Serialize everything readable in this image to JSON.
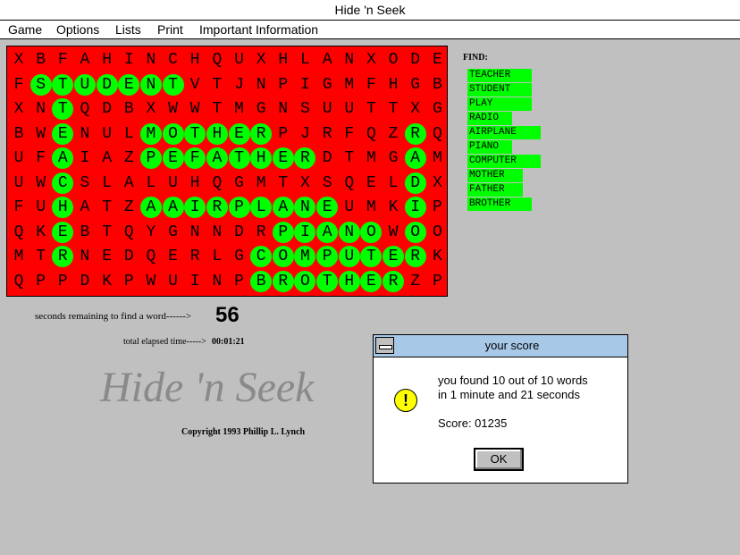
{
  "window": {
    "title": "Hide 'n Seek"
  },
  "menu": [
    "Game",
    "Options",
    "Lists",
    "Print",
    "Important Information"
  ],
  "grid": {
    "rows": [
      "XBFAHINCHQUXHLANXODE",
      "FSTUDENTVTJNPIGMFHGB",
      "XNTQDBXWWTMGNSUUTTXG",
      "BWENULMOTHERPJRFQZRQ",
      "UFAIAZPEFATHERDTMGAM",
      "UWCSLALUHQGMTXSQELDX",
      "FUHATZAAIRPLANEUMKIP",
      "QKEBTQYGNNDRPIANOWOO",
      "MTRNEDQERLGCOMPUTERK",
      "QPPDKPWUINPBROTHERZP"
    ],
    "found_words_cells": [
      [
        1,
        1
      ],
      [
        1,
        2
      ],
      [
        1,
        3
      ],
      [
        1,
        4
      ],
      [
        1,
        5
      ],
      [
        1,
        6
      ],
      [
        1,
        7
      ],
      [
        2,
        2
      ],
      [
        3,
        2
      ],
      [
        4,
        2
      ],
      [
        5,
        2
      ],
      [
        6,
        2
      ],
      [
        7,
        2
      ],
      [
        8,
        2
      ],
      [
        3,
        6
      ],
      [
        3,
        7
      ],
      [
        3,
        8
      ],
      [
        3,
        9
      ],
      [
        3,
        10
      ],
      [
        3,
        11
      ],
      [
        4,
        6
      ],
      [
        4,
        7
      ],
      [
        4,
        8
      ],
      [
        4,
        9
      ],
      [
        4,
        10
      ],
      [
        4,
        11
      ],
      [
        4,
        12
      ],
      [
        4,
        13
      ],
      [
        3,
        18
      ],
      [
        4,
        18
      ],
      [
        5,
        18
      ],
      [
        6,
        18
      ],
      [
        7,
        18
      ],
      [
        6,
        6
      ],
      [
        6,
        7
      ],
      [
        6,
        8
      ],
      [
        6,
        9
      ],
      [
        6,
        10
      ],
      [
        6,
        11
      ],
      [
        6,
        12
      ],
      [
        6,
        13
      ],
      [
        6,
        14
      ],
      [
        7,
        12
      ],
      [
        7,
        13
      ],
      [
        7,
        14
      ],
      [
        7,
        15
      ],
      [
        7,
        16
      ],
      [
        8,
        11
      ],
      [
        8,
        12
      ],
      [
        8,
        13
      ],
      [
        8,
        14
      ],
      [
        8,
        15
      ],
      [
        8,
        16
      ],
      [
        8,
        17
      ],
      [
        8,
        18
      ],
      [
        9,
        11
      ],
      [
        9,
        12
      ],
      [
        9,
        13
      ],
      [
        9,
        14
      ],
      [
        9,
        15
      ],
      [
        9,
        16
      ],
      [
        9,
        17
      ]
    ]
  },
  "find_label": "FIND:",
  "words": [
    "TEACHER",
    "STUDENT",
    "PLAY",
    "RADIO",
    "AIRPLANE",
    "PIANO",
    "COMPUTER",
    "MOTHER",
    "FATHER",
    "BROTHER"
  ],
  "status": {
    "seconds_label": "seconds remaining to find a word------>",
    "seconds_value": "56",
    "elapsed_label": "total elapsed time----->",
    "elapsed_value": "00:01:21"
  },
  "logo_text": "Hide 'n Seek",
  "copyright": "Copyright 1993 Phillip L. Lynch",
  "dialog": {
    "title": "your score",
    "line1": "you found  10 out of  10 words",
    "line2": "in 1 minute and 21 seconds",
    "score": "Score: 01235",
    "ok_label": "OK"
  }
}
